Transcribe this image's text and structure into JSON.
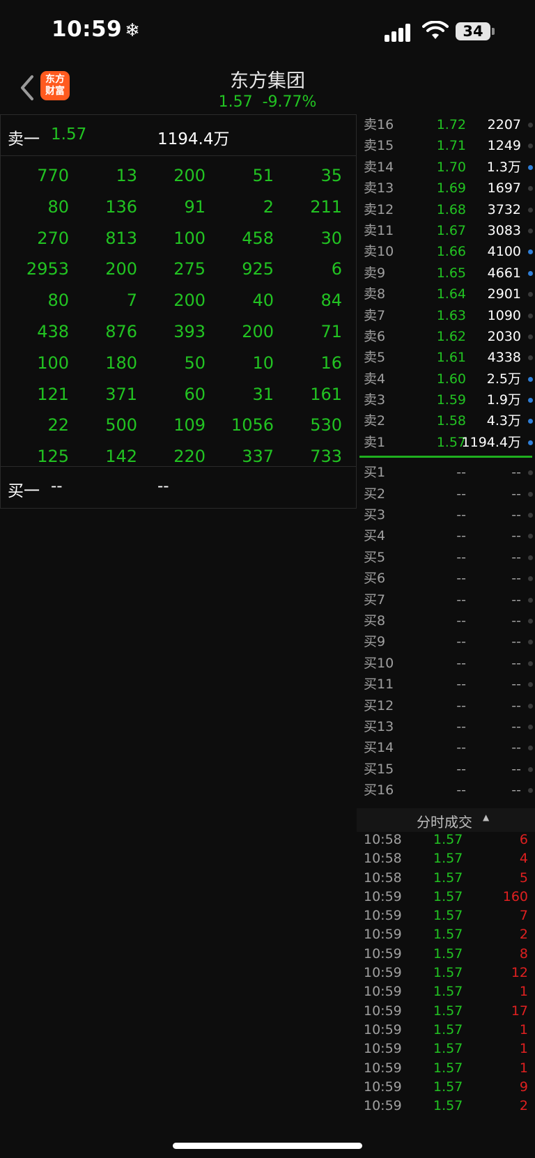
{
  "status": {
    "time": "10:59",
    "battery": "34"
  },
  "header": {
    "logo_line1": "东方",
    "logo_line2": "财富",
    "title": "东方集团",
    "price": "1.57",
    "change": "-9.77%"
  },
  "detail": {
    "sell1_label": "卖一",
    "sell1_price": "1.57",
    "sell1_volume": "1194.4万",
    "queue": [
      [
        "770",
        "13",
        "200",
        "51",
        "35"
      ],
      [
        "80",
        "136",
        "91",
        "2",
        "211"
      ],
      [
        "270",
        "813",
        "100",
        "458",
        "30"
      ],
      [
        "2953",
        "200",
        "275",
        "925",
        "6"
      ],
      [
        "80",
        "7",
        "200",
        "40",
        "84"
      ],
      [
        "438",
        "876",
        "393",
        "200",
        "71"
      ],
      [
        "100",
        "180",
        "50",
        "10",
        "16"
      ],
      [
        "121",
        "371",
        "60",
        "31",
        "161"
      ],
      [
        "22",
        "500",
        "109",
        "1056",
        "530"
      ],
      [
        "125",
        "142",
        "220",
        "337",
        "733"
      ]
    ],
    "buy1_label": "买一",
    "buy1_price": "--",
    "buy1_volume": "--"
  },
  "asks": [
    {
      "label": "卖16",
      "price": "1.72",
      "vol": "2207",
      "dot": "gray"
    },
    {
      "label": "卖15",
      "price": "1.71",
      "vol": "1249",
      "dot": "gray"
    },
    {
      "label": "卖14",
      "price": "1.70",
      "vol": "1.3万",
      "dot": "blue"
    },
    {
      "label": "卖13",
      "price": "1.69",
      "vol": "1697",
      "dot": "gray"
    },
    {
      "label": "卖12",
      "price": "1.68",
      "vol": "3732",
      "dot": "gray"
    },
    {
      "label": "卖11",
      "price": "1.67",
      "vol": "3083",
      "dot": "gray"
    },
    {
      "label": "卖10",
      "price": "1.66",
      "vol": "4100",
      "dot": "blue"
    },
    {
      "label": "卖9",
      "price": "1.65",
      "vol": "4661",
      "dot": "blue"
    },
    {
      "label": "卖8",
      "price": "1.64",
      "vol": "2901",
      "dot": "gray"
    },
    {
      "label": "卖7",
      "price": "1.63",
      "vol": "1090",
      "dot": "gray"
    },
    {
      "label": "卖6",
      "price": "1.62",
      "vol": "2030",
      "dot": "gray"
    },
    {
      "label": "卖5",
      "price": "1.61",
      "vol": "4338",
      "dot": "gray"
    },
    {
      "label": "卖4",
      "price": "1.60",
      "vol": "2.5万",
      "dot": "blue"
    },
    {
      "label": "卖3",
      "price": "1.59",
      "vol": "1.9万",
      "dot": "blue"
    },
    {
      "label": "卖2",
      "price": "1.58",
      "vol": "4.3万",
      "dot": "blue"
    },
    {
      "label": "卖1",
      "price": "1.57",
      "vol": "1194.4万",
      "dot": "blue"
    }
  ],
  "bids": [
    {
      "label": "买1",
      "price": "--",
      "vol": "--"
    },
    {
      "label": "买2",
      "price": "--",
      "vol": "--"
    },
    {
      "label": "买3",
      "price": "--",
      "vol": "--"
    },
    {
      "label": "买4",
      "price": "--",
      "vol": "--"
    },
    {
      "label": "买5",
      "price": "--",
      "vol": "--"
    },
    {
      "label": "买6",
      "price": "--",
      "vol": "--"
    },
    {
      "label": "买7",
      "price": "--",
      "vol": "--"
    },
    {
      "label": "买8",
      "price": "--",
      "vol": "--"
    },
    {
      "label": "买9",
      "price": "--",
      "vol": "--"
    },
    {
      "label": "买10",
      "price": "--",
      "vol": "--"
    },
    {
      "label": "买11",
      "price": "--",
      "vol": "--"
    },
    {
      "label": "买12",
      "price": "--",
      "vol": "--"
    },
    {
      "label": "买13",
      "price": "--",
      "vol": "--"
    },
    {
      "label": "买14",
      "price": "--",
      "vol": "--"
    },
    {
      "label": "买15",
      "price": "--",
      "vol": "--"
    },
    {
      "label": "买16",
      "price": "--",
      "vol": "--"
    }
  ],
  "ticks_title": "分时成交",
  "ticks": [
    {
      "time": "10:58",
      "price": "1.57",
      "vol": "6"
    },
    {
      "time": "10:58",
      "price": "1.57",
      "vol": "4"
    },
    {
      "time": "10:58",
      "price": "1.57",
      "vol": "5"
    },
    {
      "time": "10:59",
      "price": "1.57",
      "vol": "160"
    },
    {
      "time": "10:59",
      "price": "1.57",
      "vol": "7"
    },
    {
      "time": "10:59",
      "price": "1.57",
      "vol": "2"
    },
    {
      "time": "10:59",
      "price": "1.57",
      "vol": "8"
    },
    {
      "time": "10:59",
      "price": "1.57",
      "vol": "12"
    },
    {
      "time": "10:59",
      "price": "1.57",
      "vol": "1"
    },
    {
      "time": "10:59",
      "price": "1.57",
      "vol": "17"
    },
    {
      "time": "10:59",
      "price": "1.57",
      "vol": "1"
    },
    {
      "time": "10:59",
      "price": "1.57",
      "vol": "1"
    },
    {
      "time": "10:59",
      "price": "1.57",
      "vol": "1"
    },
    {
      "time": "10:59",
      "price": "1.57",
      "vol": "9"
    },
    {
      "time": "10:59",
      "price": "1.57",
      "vol": "2"
    }
  ],
  "colors": {
    "up": "#e02020",
    "down": "#22c322",
    "dot_blue": "#2f7fd8"
  }
}
